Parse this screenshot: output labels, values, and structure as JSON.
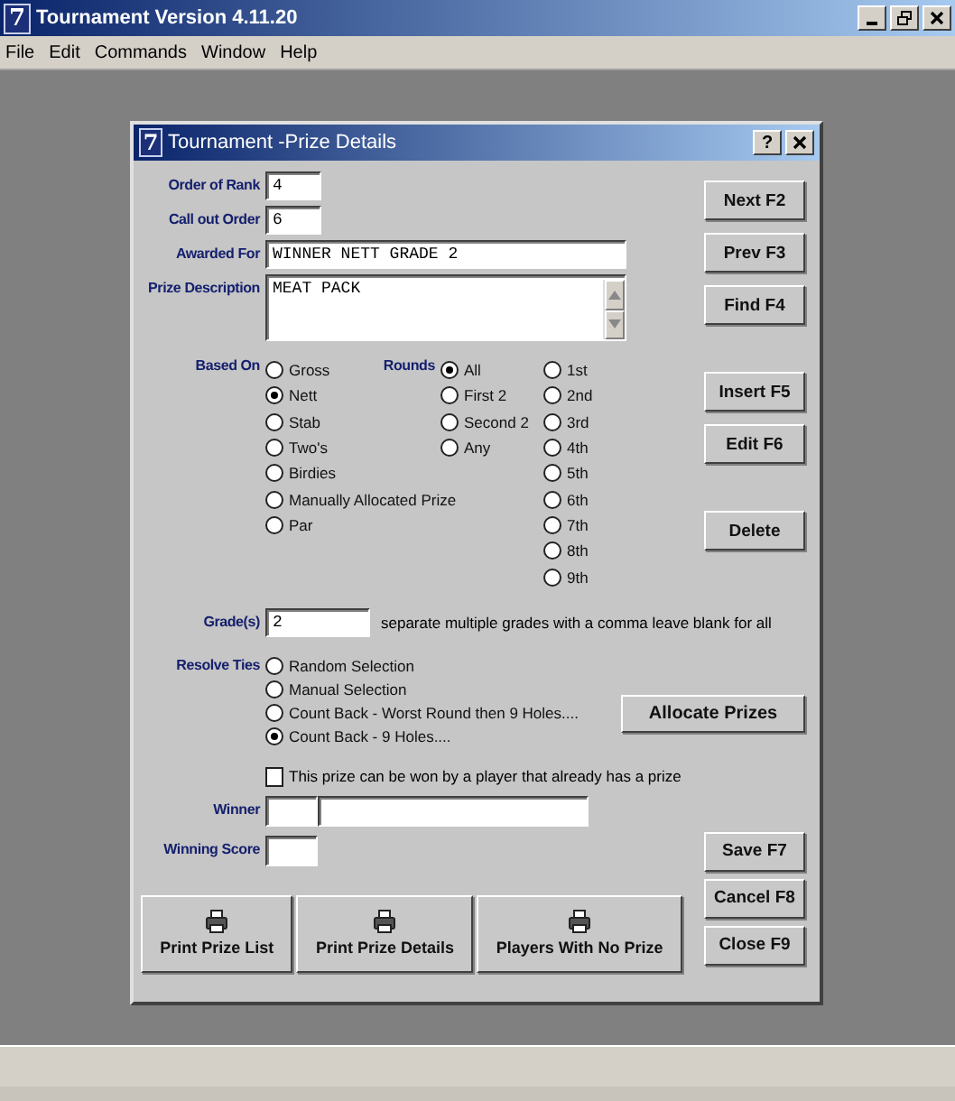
{
  "app": {
    "logo": "7",
    "title": "Tournament Version 4.11.20"
  },
  "menu": [
    {
      "label": "File"
    },
    {
      "label": "Edit"
    },
    {
      "label": "Commands"
    },
    {
      "label": "Window"
    },
    {
      "label": "Help"
    }
  ],
  "dialog": {
    "logo": "7",
    "title": "Tournament -Prize Details",
    "help": "?"
  },
  "fields": [
    {
      "kind": "short",
      "label": "Order of Rank",
      "value": "4"
    },
    {
      "kind": "short",
      "label": "Call out Order",
      "value": "6"
    },
    {
      "kind": "long",
      "label": "Awarded For",
      "value": "WINNER NETT GRADE 2"
    },
    {
      "kind": "area",
      "label": "Prize Description",
      "value": "MEAT PACK"
    }
  ],
  "based_on": {
    "label": "Based On",
    "options": [
      {
        "label": "Gross",
        "selected": false
      },
      {
        "label": "Nett",
        "selected": true
      },
      {
        "label": "Stab",
        "selected": false
      },
      {
        "label": "Two's",
        "selected": false
      },
      {
        "label": "Birdies",
        "selected": false
      },
      {
        "label": "Manually Allocated Prize",
        "selected": false
      },
      {
        "label": "Par",
        "selected": false
      }
    ]
  },
  "rounds": {
    "label": "Rounds",
    "options": [
      {
        "label": "All",
        "selected": true
      },
      {
        "label": "First 2",
        "selected": false
      },
      {
        "label": "Second 2",
        "selected": false
      },
      {
        "label": "Any",
        "selected": false
      }
    ]
  },
  "round_numbers": [
    {
      "label": "1st",
      "selected": false
    },
    {
      "label": "2nd",
      "selected": false
    },
    {
      "label": "3rd",
      "selected": false
    },
    {
      "label": "4th",
      "selected": false
    },
    {
      "label": "5th",
      "selected": false
    },
    {
      "label": "6th",
      "selected": false
    },
    {
      "label": "7th",
      "selected": false
    },
    {
      "label": "8th",
      "selected": false
    },
    {
      "label": "9th",
      "selected": false
    }
  ],
  "grades": {
    "label": "Grade(s)",
    "value": "2",
    "hint": "separate multiple grades with a comma leave blank for all"
  },
  "resolve_ties": {
    "label": "Resolve Ties",
    "options": [
      {
        "label": "Random Selection",
        "selected": false
      },
      {
        "label": "Manual Selection",
        "selected": false
      },
      {
        "label": "Count Back - Worst Round then 9 Holes....",
        "selected": false
      },
      {
        "label": "Count Back - 9 Holes....",
        "selected": true
      }
    ]
  },
  "allocate_button": "Allocate Prizes",
  "repeat_winner": {
    "label": "This prize can be won by a player that already has a prize",
    "checked": false
  },
  "winner": {
    "label": "Winner"
  },
  "winning_score": {
    "label": "Winning Score"
  },
  "side_buttons": [
    [
      "Next F2",
      "Prev F3",
      "Find F4"
    ],
    [
      "Insert F5",
      "Edit F6"
    ],
    [
      "Delete"
    ]
  ],
  "print_buttons": [
    "Print Prize List",
    "Print Prize Details",
    "Players With No Prize"
  ],
  "action_buttons": [
    "Save F7",
    "Cancel F8",
    "Close F9"
  ]
}
